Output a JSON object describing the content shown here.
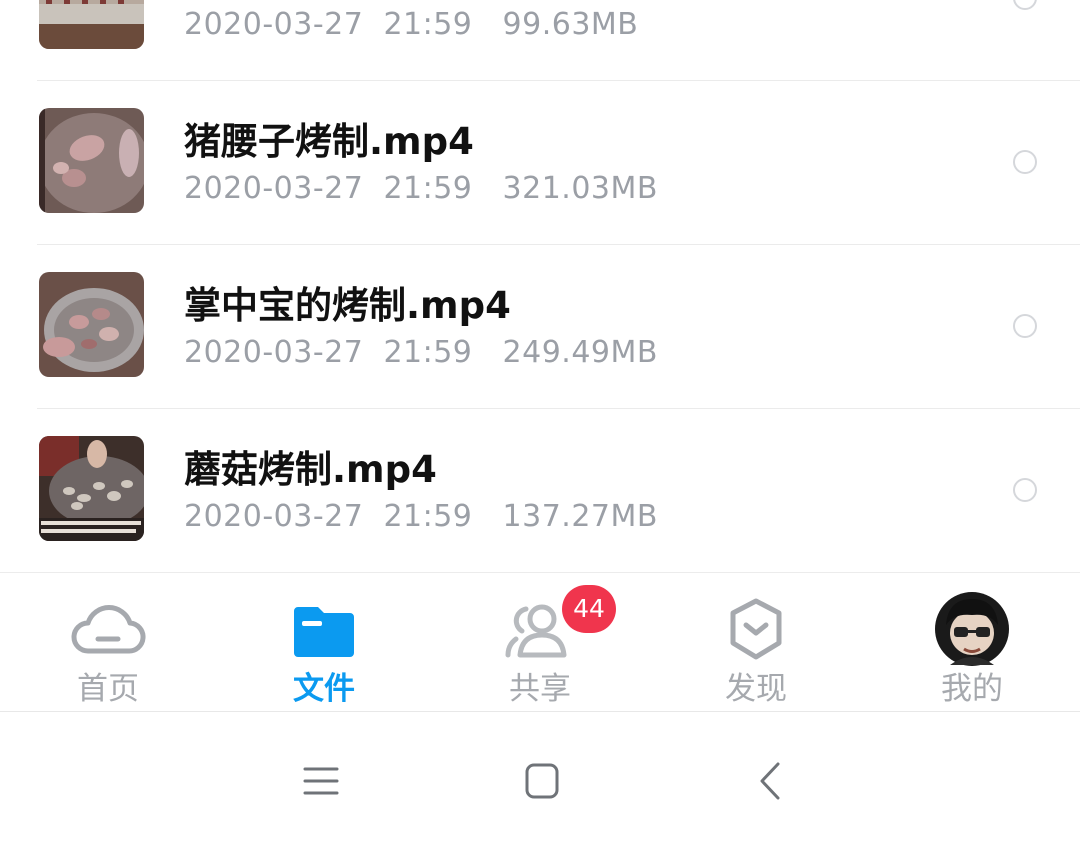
{
  "files": [
    {
      "name": "",
      "date": "2020-03-27",
      "time": "21:59",
      "size": "99.63MB",
      "thumb": "grill-thumbnail"
    },
    {
      "name": "猪腰子烤制.mp4",
      "date": "2020-03-27",
      "time": "21:59",
      "size": "321.03MB",
      "thumb": "kidney-thumbnail"
    },
    {
      "name": "掌中宝的烤制.mp4",
      "date": "2020-03-27",
      "time": "21:59",
      "size": "249.49MB",
      "thumb": "bowl-thumbnail"
    },
    {
      "name": "蘑菇烤制.mp4",
      "date": "2020-03-27",
      "time": "21:59",
      "size": "137.27MB",
      "thumb": "mushroom-thumbnail"
    }
  ],
  "tabbar": {
    "tabs": [
      {
        "label": "首页",
        "icon": "cloud-icon",
        "active": false
      },
      {
        "label": "文件",
        "icon": "folder-icon",
        "active": true
      },
      {
        "label": "共享",
        "icon": "users-icon",
        "active": false
      },
      {
        "label": "发现",
        "icon": "hexagon-icon",
        "active": false
      },
      {
        "label": "我的",
        "icon": "avatar",
        "active": false
      }
    ],
    "share_badge": "44"
  },
  "colors": {
    "accent": "#0b9af0",
    "badge": "#f0354d",
    "inactive": "#a6a9ae",
    "meta_text": "#9b9fa6"
  },
  "system_nav": [
    "menu-icon",
    "home-icon",
    "back-icon"
  ]
}
